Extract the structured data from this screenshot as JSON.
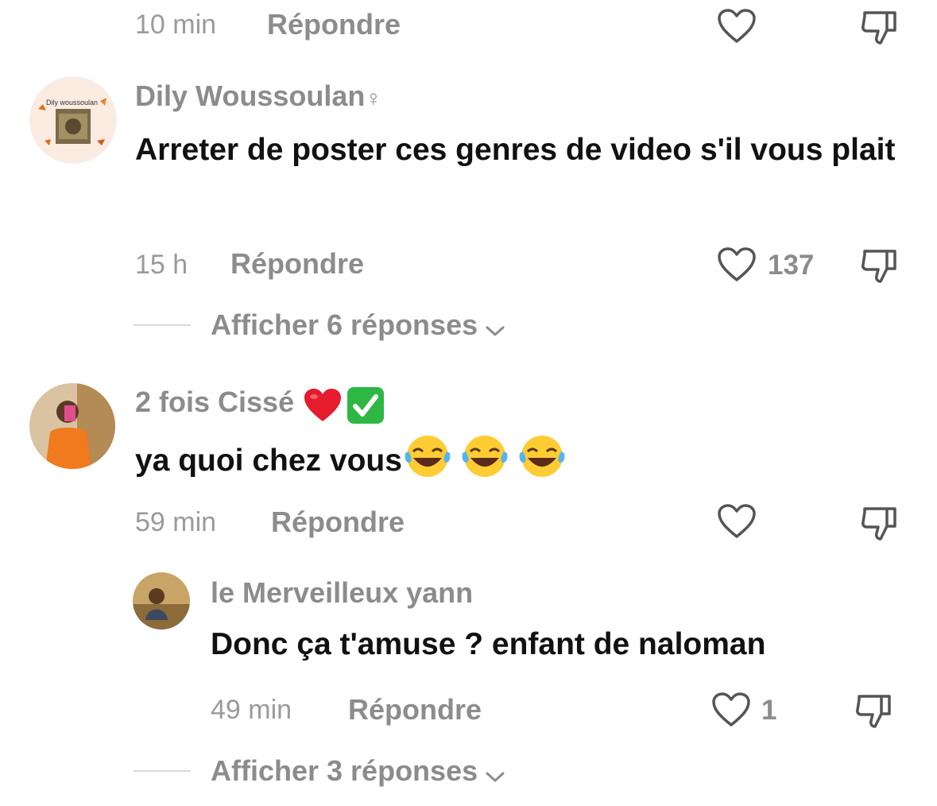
{
  "comments": [
    {
      "time": "10 min",
      "reply_label": "Répondre",
      "likes": ""
    },
    {
      "username": "Dily Woussoulan",
      "username_suffix": "♀",
      "avatar_text": "Dily woussoulan",
      "text": "Arreter de poster ces genres de video s'il vous plait",
      "time": "15 h",
      "reply_label": "Répondre",
      "likes": "137",
      "view_replies": "Afficher 6 réponses"
    },
    {
      "username": "2 fois Cissé",
      "text": "ya quoi chez vous",
      "time": "59 min",
      "reply_label": "Répondre",
      "likes": ""
    },
    {
      "username": "le Merveilleux yann",
      "text": "Donc ça t'amuse ? enfant de naloman",
      "time": "49 min",
      "reply_label": "Répondre",
      "likes": "1",
      "view_replies": "Afficher 3 réponses"
    }
  ],
  "icons": {
    "like": "heart-outline-icon",
    "dislike": "thumbs-down-outline-icon",
    "expand": "chevron-down-icon",
    "user_emoji_1": "red-heart-emoji",
    "user_emoji_2": "green-check-emoji",
    "laugh": "tears-of-joy-emoji"
  },
  "colors": {
    "text": "#111111",
    "secondary": "#8c8c8c",
    "time": "#9a9a9a",
    "divider": "#d8d8d8",
    "icon": "#555555"
  }
}
